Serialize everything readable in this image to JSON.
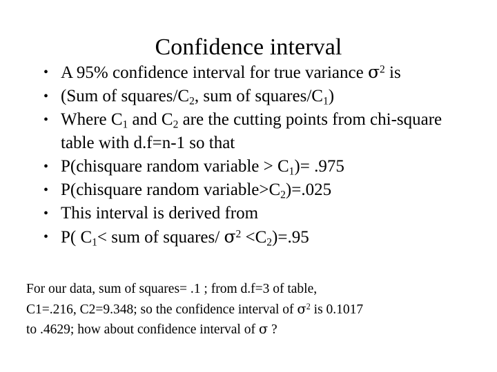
{
  "slide": {
    "title": "Confidence interval",
    "background_color": "#ffffff",
    "text_color": "#000000",
    "bullet_marker": "•",
    "bullets": [
      {
        "id": "bullet-variance-interval",
        "segments": [
          {
            "type": "text",
            "value": "A 95% confidence interval for true variance "
          },
          {
            "type": "sigma",
            "value": "σ"
          },
          {
            "type": "sup",
            "value": "2"
          },
          {
            "type": "text",
            "value": " is"
          }
        ],
        "plain": "A 95% confidence interval for true variance σ2 is"
      },
      {
        "id": "bullet-interval-formula",
        "segments": [
          {
            "type": "text",
            "value": "(Sum of squares/C"
          },
          {
            "type": "sub",
            "value": "2"
          },
          {
            "type": "text",
            "value": ", sum of squares/C"
          },
          {
            "type": "sub",
            "value": "1"
          },
          {
            "type": "text",
            "value": ")"
          }
        ],
        "plain": "(Sum of squares/C2, sum of squares/C1)"
      },
      {
        "id": "bullet-cutting-points",
        "segments": [
          {
            "type": "text",
            "value": "Where C"
          },
          {
            "type": "sub",
            "value": "1"
          },
          {
            "type": "text",
            "value": " and C"
          },
          {
            "type": "sub",
            "value": "2"
          },
          {
            "type": "text",
            "value": " are the cutting points from chi-square table with d.f=n-1 so that"
          }
        ],
        "plain": "Where C1 and C2 are the cutting points from chi-square table with d.f=n-1 so that"
      },
      {
        "id": "bullet-prob-c1",
        "segments": [
          {
            "type": "text",
            "value": "P(chisquare random variable > C"
          },
          {
            "type": "sub",
            "value": "1"
          },
          {
            "type": "text",
            "value": ")= .975"
          }
        ],
        "plain": "P(chisquare random variable > C1)= .975"
      },
      {
        "id": "bullet-prob-c2",
        "segments": [
          {
            "type": "text",
            "value": "P(chisquare random variable>C"
          },
          {
            "type": "sub",
            "value": "2"
          },
          {
            "type": "text",
            "value": ")=.025"
          }
        ],
        "plain": "P(chisquare random variable>C2)=.025"
      },
      {
        "id": "bullet-derived-from",
        "segments": [
          {
            "type": "text",
            "value": "This interval is derived from"
          }
        ],
        "plain": "This interval is derived from"
      },
      {
        "id": "bullet-derivation-probability",
        "segments": [
          {
            "type": "text",
            "value": "P( C"
          },
          {
            "type": "sub",
            "value": "1"
          },
          {
            "type": "text",
            "value": "< sum of squares/ "
          },
          {
            "type": "sigma",
            "value": "σ"
          },
          {
            "type": "sup",
            "value": "2"
          },
          {
            "type": "text",
            "value": " <C"
          },
          {
            "type": "sub",
            "value": "2"
          },
          {
            "type": "text",
            "value": ")=.95"
          }
        ],
        "plain": "P( C1< sum of squares/ σ2 <C2)=.95"
      }
    ],
    "note": {
      "lines": [
        {
          "id": "note-line-1",
          "segments": [
            {
              "type": "text",
              "value": "For our data, sum of squares= .1 ;  from d.f=3 of table,"
            }
          ],
          "plain": "For our data, sum of squares= .1 ;  from d.f=3 of table,"
        },
        {
          "id": "note-line-2",
          "segments": [
            {
              "type": "text",
              "value": "C1=.216, C2=9.348; so the confidence interval of "
            },
            {
              "type": "sigma",
              "value": "σ"
            },
            {
              "type": "sup",
              "value": "2"
            },
            {
              "type": "text",
              "value": " is 0.1017"
            }
          ],
          "plain": "C1=.216, C2=9.348; so the confidence interval of σ2 is 0.1017"
        },
        {
          "id": "note-line-3",
          "segments": [
            {
              "type": "text",
              "value": "to .4629;  how about confidence interval of "
            },
            {
              "type": "sigma",
              "value": "σ"
            },
            {
              "type": "text",
              "value": " ?"
            }
          ],
          "plain": "to .4629;  how about confidence interval of σ ?"
        }
      ]
    }
  }
}
